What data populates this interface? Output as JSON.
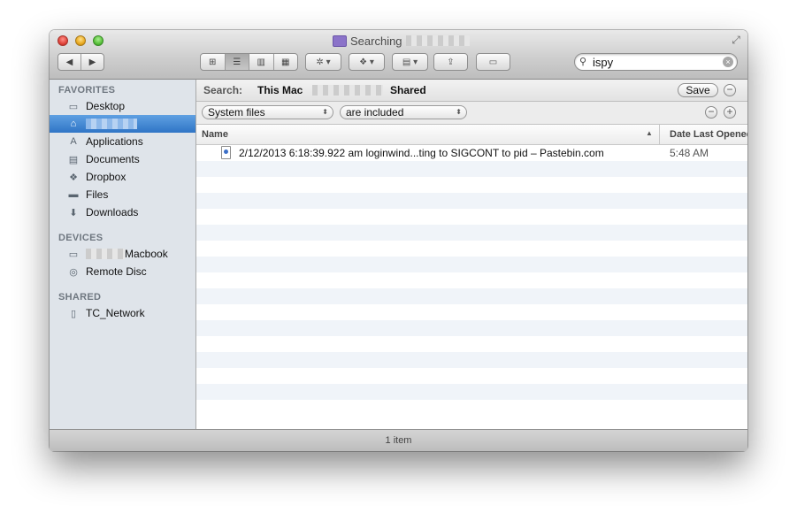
{
  "window": {
    "title": "Searching",
    "fullscreen_glyph": "⤢"
  },
  "toolbar": {
    "back_glyph": "◀",
    "forward_glyph": "▶",
    "view_icons_glyph": "⊞",
    "view_list_glyph": "☰",
    "view_columns_glyph": "▥",
    "view_coverflow_glyph": "▦",
    "action_glyph": "✲ ▾",
    "dropbox_glyph": "❖ ▾",
    "arrange_glyph": "▤ ▾",
    "share_glyph": "⇪",
    "tags_glyph": "▭"
  },
  "search": {
    "value": "ispy",
    "clear_glyph": "×",
    "magnifier_glyph": "⚲"
  },
  "sidebar": {
    "favorites_heading": "FAVORITES",
    "favorites": [
      {
        "label": "Desktop",
        "icon": "desktop-icon",
        "glyph": "▭"
      },
      {
        "label": "",
        "icon": "home-icon",
        "glyph": "⌂",
        "selected": true
      },
      {
        "label": "Applications",
        "icon": "applications-icon",
        "glyph": "A"
      },
      {
        "label": "Documents",
        "icon": "documents-icon",
        "glyph": "▤"
      },
      {
        "label": "Dropbox",
        "icon": "dropbox-icon",
        "glyph": "❖"
      },
      {
        "label": "Files",
        "icon": "folder-icon",
        "glyph": "▬"
      },
      {
        "label": "Downloads",
        "icon": "downloads-icon",
        "glyph": "⬇"
      }
    ],
    "devices_heading": "DEVICES",
    "devices": [
      {
        "label": "Macbook",
        "icon": "laptop-icon",
        "glyph": "▭"
      },
      {
        "label": "Remote Disc",
        "icon": "disc-icon",
        "glyph": "◎"
      }
    ],
    "shared_heading": "SHARED",
    "shared": [
      {
        "label": "TC_Network",
        "icon": "server-icon",
        "glyph": "▯"
      }
    ]
  },
  "searchbar": {
    "label": "Search:",
    "scope_this_mac": "This Mac",
    "scope_shared": "Shared",
    "save_label": "Save",
    "remove_glyph": "−"
  },
  "criteria": {
    "kind": "System files",
    "condition": "are included",
    "remove_glyph": "−",
    "add_glyph": "+"
  },
  "columns": {
    "name": "Name",
    "date": "Date Last Opened",
    "sort_glyph": "▲"
  },
  "results": [
    {
      "name": "2/12/2013 6:18:39.922 am loginwind...ting to SIGCONT to pid – Pastebin.com",
      "date": "5:48 AM"
    }
  ],
  "status": {
    "text": "1 item"
  }
}
